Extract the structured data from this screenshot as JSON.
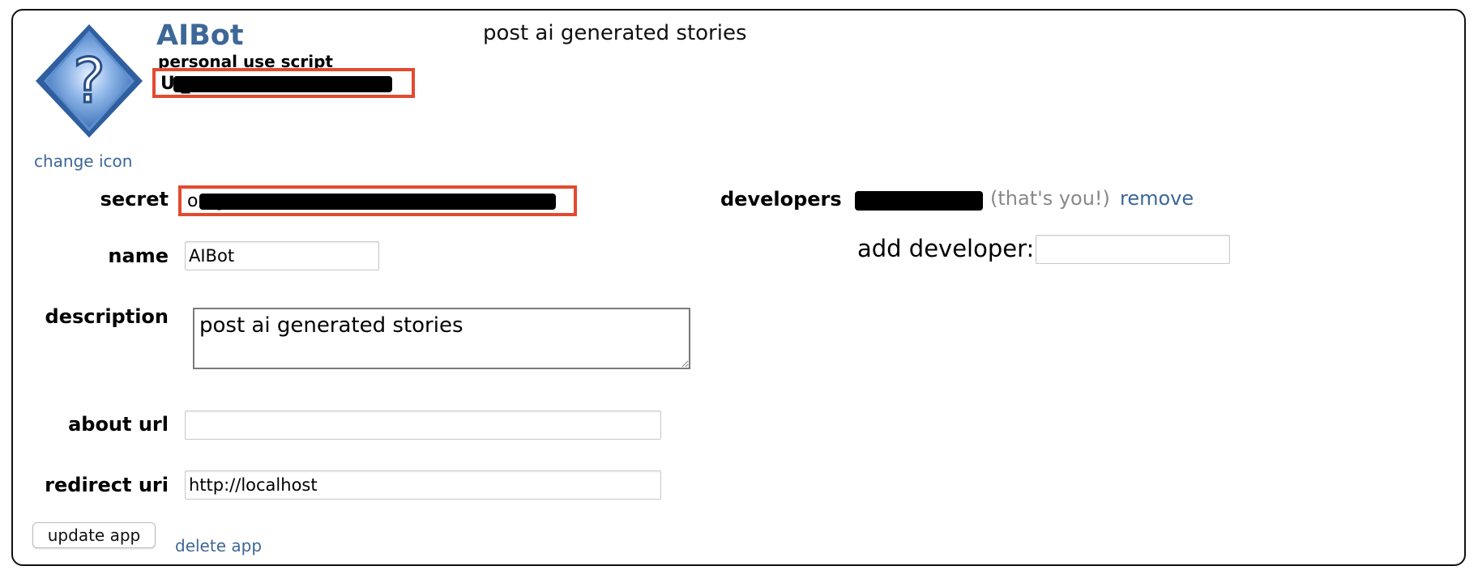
{
  "app": {
    "name": "AIBot",
    "type": "personal use script",
    "client_id_visible": "U                    _w",
    "description_header": "post ai generated stories",
    "change_icon_label": "change icon"
  },
  "form": {
    "secret_label": "secret",
    "secret_visible": "o                                                        vg",
    "name_label": "name",
    "name_value": "AIBot",
    "description_label": "description",
    "description_value": "post ai generated stories",
    "about_url_label": "about url",
    "about_url_value": "",
    "redirect_uri_label": "redirect uri",
    "redirect_uri_value": "http://localhost"
  },
  "developers": {
    "label": "developers",
    "you_note": "(that's you!)",
    "remove_label": "remove",
    "add_label": "add developer:",
    "add_value": ""
  },
  "actions": {
    "update_label": "update app",
    "delete_label": "delete app"
  },
  "colors": {
    "link": "#3d6797",
    "redaction_outline": "#e34a2f",
    "icon_blue": "#4a7fc4"
  },
  "icons": {
    "app_icon": "question-mark-diamond-icon"
  }
}
